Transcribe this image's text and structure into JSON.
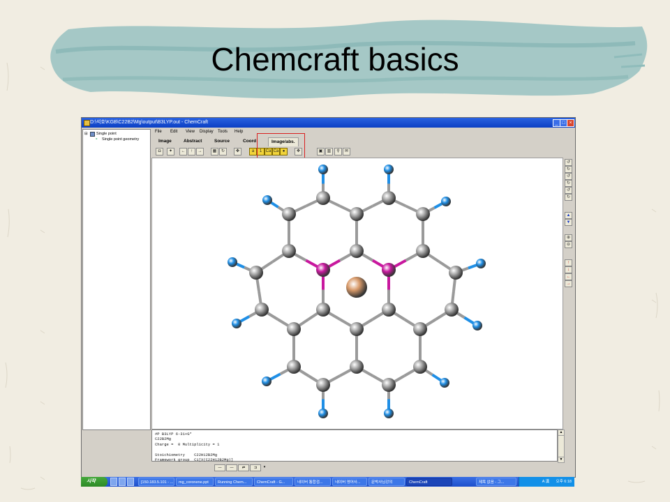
{
  "slide": {
    "title": "Chemcraft basics"
  },
  "window": {
    "title": "D:\\석호\\KGB\\C22B2\\Mg\\output\\B3LYP.out - ChemCraft",
    "minimize": "_",
    "maximize": "□",
    "close": "×"
  },
  "tree": {
    "root": "Single point",
    "child": "Single point geometry",
    "root_toggle": "⊟"
  },
  "menu": [
    "File",
    "Edit",
    "View",
    "Display",
    "Tools",
    "Help"
  ],
  "tabs": [
    "Image",
    "Abstract",
    "Source",
    "Coord",
    "Image/abs."
  ],
  "output": {
    "lines": [
      "#P B3LYP 6-31+G*",
      "C22B2Mg",
      "Charge =  0 Multiplicity = 1",
      "",
      "Stoichiometry    C22H12B2Mg",
      "Framework group  C1[X(C22H12B2Mg)]"
    ]
  },
  "toolbar_labels": {
    "buttons_group2": [
      "Ca",
      "Ca"
    ]
  },
  "molecule": {
    "colors": {
      "carbon": "#a6a6a6",
      "hydrogen": "#1f8fe6",
      "boron": "#c8189e",
      "magnesium": "#d89a6a"
    }
  },
  "taskbar": {
    "start": "시작",
    "tasks": [
      "[150.183.5.101 - ...",
      "mg_coronene.ppt",
      "Running Chem...",
      "ChemCraft - G...",
      "네이버 통합검...",
      "네이버 영어사...",
      "문박사님강의",
      "ChemCraft",
      "제목 없음 - 그..."
    ],
    "tray_lang": "A 漢",
    "tray_time": "오후 6:18"
  },
  "accent_color": "#d91f1f"
}
